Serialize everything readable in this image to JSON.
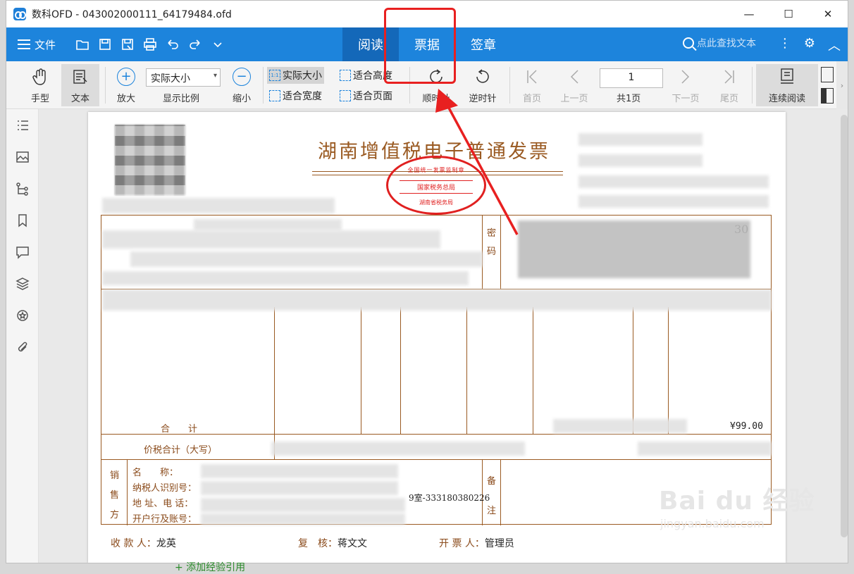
{
  "window": {
    "title": "数科OFD - 043002000111_64179484.ofd",
    "minimize": "—",
    "maximize": "☐",
    "close": "✕"
  },
  "menubar": {
    "file_label": "文件",
    "tabs": [
      {
        "label": "阅读",
        "active": true
      },
      {
        "label": "票据",
        "active": false
      },
      {
        "label": "签章",
        "active": false
      }
    ],
    "search_placeholder": "点此查找文本",
    "accent_color": "#1d84dc"
  },
  "ribbon": {
    "hand": "手型",
    "text": "文本",
    "zoom_in": "放大",
    "zoom_value": "实际大小",
    "zoom_caption": "显示比例",
    "zoom_out": "缩小",
    "actual_size": "实际大小",
    "fit_height": "适合高度",
    "fit_width": "适合宽度",
    "fit_page": "适合页面",
    "rotate_cw": "顺时针",
    "rotate_ccw": "逆时针",
    "first_page": "首页",
    "prev_page": "上一页",
    "page_number": "1",
    "page_total": "共1页",
    "next_page": "下一页",
    "last_page": "尾页",
    "continuous": "连续阅读"
  },
  "invoice": {
    "title": "湖南增值税电子普通发票",
    "seal_top": "全国统一发票监制章",
    "seal_mid": "国家税务总局",
    "seal_bottom": "湖南省税务局",
    "password_label_1": "密",
    "password_label_2": "码",
    "partial_code": "30",
    "total_label": "合　　计",
    "total_amount": "¥99.00",
    "amount_in_words_label": "价税合计（大写）",
    "seller_label_1": "销",
    "seller_label_2": "售",
    "seller_label_3": "方",
    "seller_name_label": "名　　称：",
    "seller_taxid_label": "纳税人识别号：",
    "seller_addr_label": "地 址、电 话：",
    "seller_bank_label": "开户行及账号：",
    "seller_addr_visible": "9室-333180380226",
    "remark_label_1": "备",
    "remark_label_2": "注",
    "payee_label": "收 款 人：",
    "payee": "龙英",
    "reviewer_label": "复　核：",
    "reviewer": "蒋文文",
    "issuer_label": "开 票 人：",
    "issuer": "管理员"
  },
  "watermark": {
    "main": "Bai du 经验",
    "sub": "jingyan.baidu.com"
  },
  "bottom_peek": "+ 添加经验引用"
}
